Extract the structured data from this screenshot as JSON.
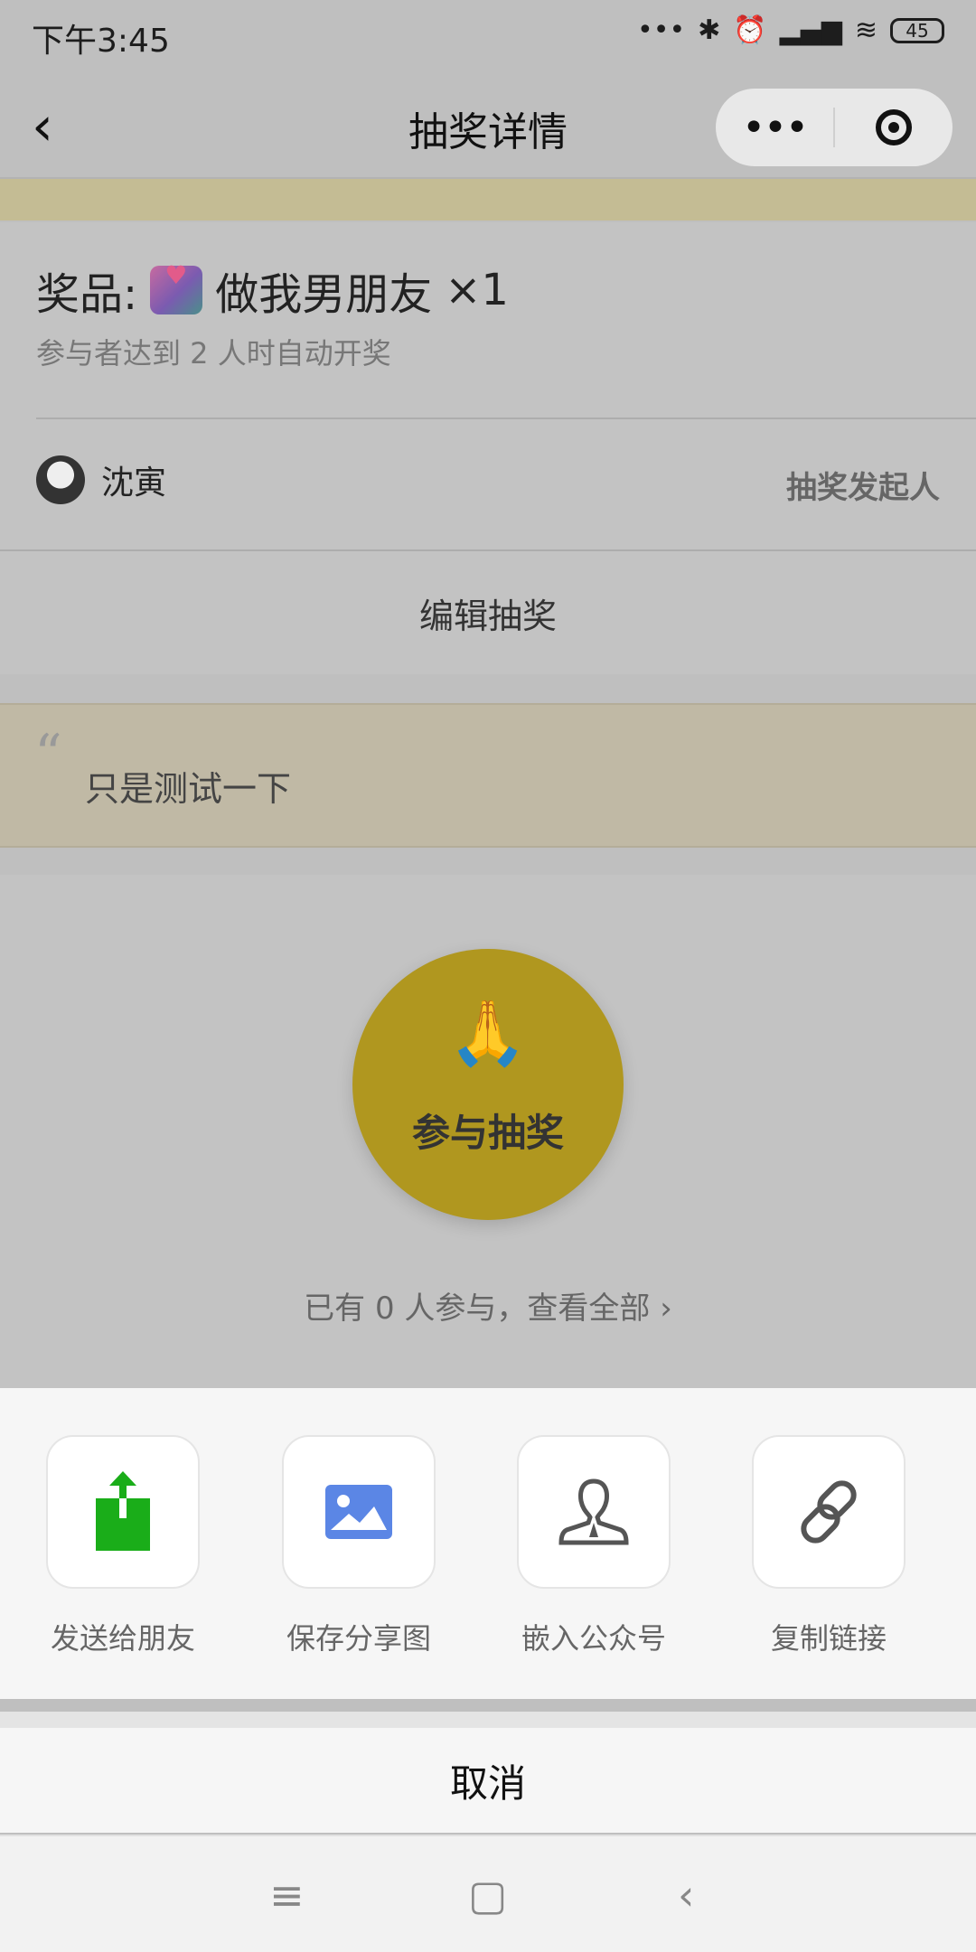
{
  "status_bar": {
    "time": "下午3:45",
    "battery": "45"
  },
  "header": {
    "title": "抽奖详情",
    "more_label": "•••"
  },
  "prize": {
    "label": "奖品:",
    "name": "做我男朋友",
    "quantity": "×1",
    "auto_draw_text": "参与者达到 2 人时自动开奖"
  },
  "organizer": {
    "name": "沈寅",
    "role": "抽奖发起人"
  },
  "edit_button": "编辑抽奖",
  "note": {
    "quote_mark": "“",
    "text": "只是测试一下"
  },
  "join": {
    "icon": "🙏",
    "label": "参与抽奖",
    "participants_text": "已有 0 人参与，查看全部 ›"
  },
  "share_options": [
    {
      "icon": "upload-icon",
      "label": "发送给朋友"
    },
    {
      "icon": "image-icon",
      "label": "保存分享图"
    },
    {
      "icon": "person-icon",
      "label": "嵌入公众号"
    },
    {
      "icon": "link-icon",
      "label": "复制链接"
    }
  ],
  "cancel_label": "取消",
  "colors": {
    "join_button": "#b0971f",
    "share_green": "#1aad19",
    "share_blue": "#5b86e5"
  }
}
